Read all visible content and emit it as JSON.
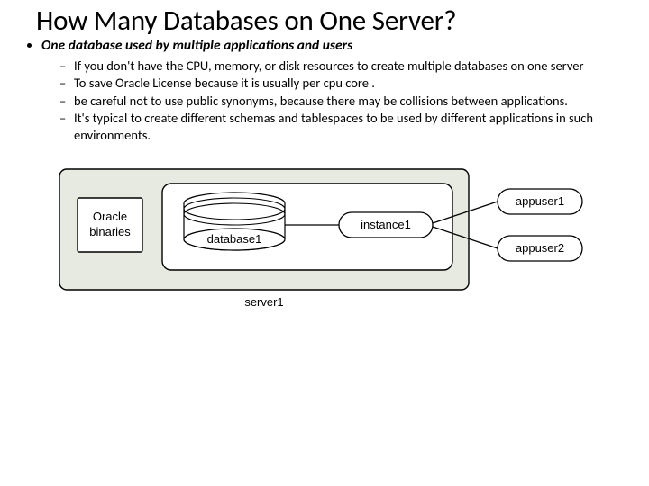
{
  "title": "How Many Databases on One Server?",
  "bullets": {
    "main": "One database used by multiple applications and users",
    "subs": [
      "If you don't have the CPU, memory, or disk resources to create multiple databases on one server",
      "To save Oracle License because it is usually per cpu core .",
      "be careful not to use public synonyms, because there may be collisions between applications.",
      "It's typical to create different schemas and tablespaces to be used by different applications in such environments."
    ]
  },
  "diagram": {
    "server_label": "server1",
    "binaries": "Oracle\nbinaries",
    "database": "database1",
    "instance": "instance1",
    "appusers": [
      "appuser1",
      "appuser2"
    ]
  }
}
